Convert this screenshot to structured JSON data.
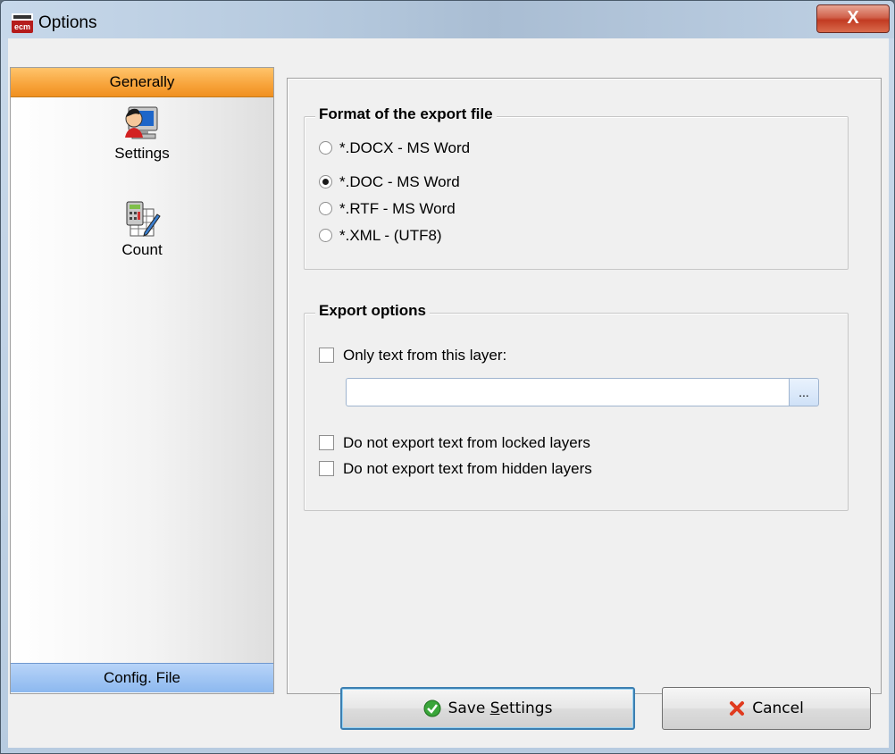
{
  "window": {
    "title": "Options",
    "close_glyph": "X"
  },
  "sidebar": {
    "header": "Generally",
    "items": [
      {
        "label": "Settings",
        "icon": "user-computer-icon"
      },
      {
        "label": "Count",
        "icon": "calculator-icon"
      }
    ],
    "footer": "Config. File"
  },
  "format_group": {
    "title": "Format of the export file",
    "options": [
      {
        "label": "*.DOCX - MS Word",
        "selected": false
      },
      {
        "label": "*.DOC - MS Word",
        "selected": true
      },
      {
        "label": "*.RTF - MS Word",
        "selected": false
      },
      {
        "label": "*.XML - (UTF8)",
        "selected": false
      }
    ]
  },
  "export_group": {
    "title": "Export options",
    "only_layer_label": "Only text from this layer:",
    "layer_value": "",
    "browse_label": "...",
    "locked_label": "Do not export text from locked layers",
    "hidden_label": "Do not export text from hidden layers"
  },
  "buttons": {
    "save_pre": "Save ",
    "save_accel": "S",
    "save_post": "ettings",
    "cancel": "Cancel"
  },
  "colors": {
    "sidebar_header": "#f7a33a",
    "sidebar_footer": "#8cb8ef",
    "default_button_border": "#3c7fb1"
  }
}
